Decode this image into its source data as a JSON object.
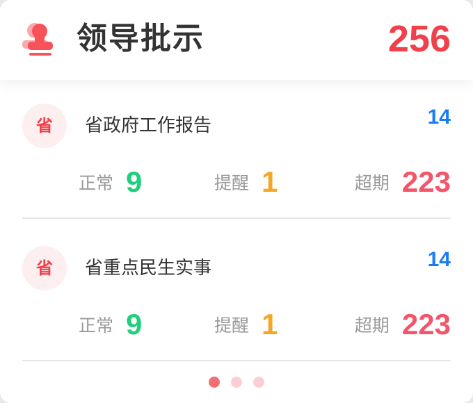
{
  "header": {
    "title": "领导批示",
    "total": "256",
    "icon": "stamp-icon"
  },
  "items": [
    {
      "badge": "省",
      "title": "省政府工作报告",
      "count": "14",
      "stats": [
        {
          "label": "正常",
          "value": "9"
        },
        {
          "label": "提醒",
          "value": "1"
        },
        {
          "label": "超期",
          "value": "223"
        }
      ]
    },
    {
      "badge": "省",
      "title": "省重点民生实事",
      "count": "14",
      "stats": [
        {
          "label": "正常",
          "value": "9"
        },
        {
          "label": "提醒",
          "value": "1"
        },
        {
          "label": "超期",
          "value": "223"
        }
      ]
    }
  ],
  "colors": {
    "accent": "#f0404a",
    "normal": "#1ecf7e",
    "remind": "#f5a623",
    "overdue": "#f5556a",
    "count": "#1a7cf5"
  },
  "pagination": {
    "pages": 3,
    "current": 1
  }
}
